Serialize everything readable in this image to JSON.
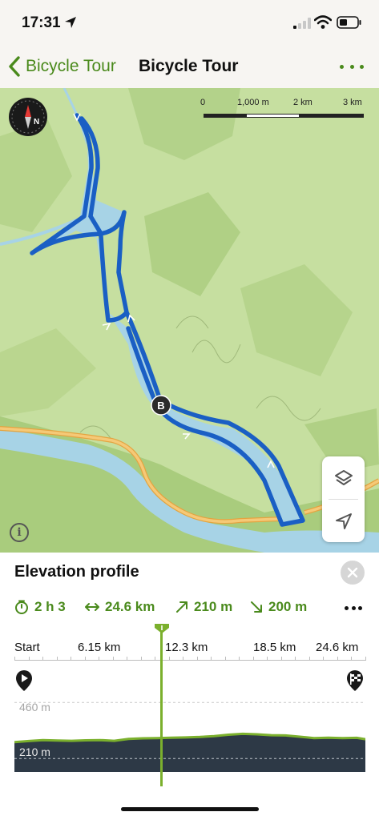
{
  "status_bar": {
    "time": "17:31",
    "icons": [
      "location-arrow-icon",
      "signal-icon",
      "wifi-icon",
      "battery-icon"
    ]
  },
  "nav": {
    "back_label": "Bicycle Tour",
    "title": "Bicycle Tour",
    "accent_color": "#4a8a1c"
  },
  "map": {
    "scale": {
      "labels": [
        "0",
        "1,000 m",
        "2 km",
        "3 km"
      ]
    },
    "route_waypoint": "B",
    "route_color": "#1a5fc4",
    "lake_color": "#a7d3e6"
  },
  "elevation": {
    "title": "Elevation profile",
    "stats": {
      "duration": "2 h 3",
      "distance": "24.6 km",
      "ascent": "210 m",
      "descent": "200 m"
    },
    "axis_labels": [
      "Start",
      "6.15 km",
      "12.3 km",
      "18.5 km",
      "24.6 km"
    ],
    "grid_labels": {
      "max": "460 m",
      "min": "210 m"
    },
    "profile_color": "#7bb02d",
    "fill_color": "#2d3946"
  },
  "chart_data": {
    "type": "area",
    "x": [
      0,
      1,
      2,
      3,
      4,
      5,
      6,
      7,
      8,
      9,
      10,
      11,
      12,
      13,
      14,
      15,
      16,
      17,
      18,
      19,
      20,
      21,
      22,
      23,
      24,
      24.6
    ],
    "y": [
      283,
      288,
      292,
      290,
      289,
      291,
      292,
      289,
      297,
      300,
      301,
      303,
      304,
      306,
      310,
      316,
      320,
      318,
      314,
      313,
      307,
      301,
      303,
      301,
      302,
      296
    ],
    "xlabel": "",
    "ylabel": "",
    "xlim": [
      0,
      24.6
    ],
    "ylim": [
      150,
      500
    ],
    "grid_values": [
      460,
      210
    ],
    "x_ticks": [
      "Start",
      "6.15 km",
      "12.3 km",
      "18.5 km",
      "24.6 km"
    ]
  }
}
